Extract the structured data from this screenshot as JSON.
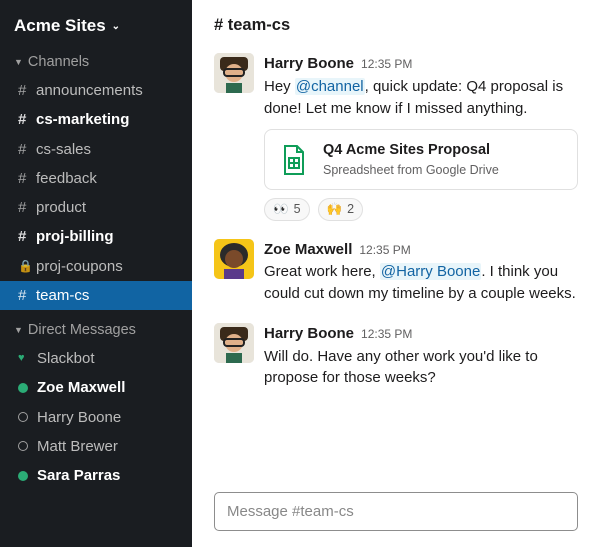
{
  "workspace": {
    "name": "Acme Sites"
  },
  "sections": {
    "channels_label": "Channels",
    "dms_label": "Direct Messages"
  },
  "channels": [
    {
      "name": "announcements",
      "unread": false,
      "active": false,
      "private": false
    },
    {
      "name": "cs-marketing",
      "unread": true,
      "active": false,
      "private": false
    },
    {
      "name": "cs-sales",
      "unread": false,
      "active": false,
      "private": false
    },
    {
      "name": "feedback",
      "unread": false,
      "active": false,
      "private": false
    },
    {
      "name": "product",
      "unread": false,
      "active": false,
      "private": false
    },
    {
      "name": "proj-billing",
      "unread": true,
      "active": false,
      "private": false
    },
    {
      "name": "proj-coupons",
      "unread": false,
      "active": false,
      "private": true
    },
    {
      "name": "team-cs",
      "unread": false,
      "active": true,
      "private": false
    }
  ],
  "dms": [
    {
      "name": "Slackbot",
      "status": "heart",
      "unread": false
    },
    {
      "name": "Zoe Maxwell",
      "status": "active",
      "unread": true
    },
    {
      "name": "Harry Boone",
      "status": "away",
      "unread": false
    },
    {
      "name": "Matt Brewer",
      "status": "away",
      "unread": false
    },
    {
      "name": "Sara Parras",
      "status": "active",
      "unread": true
    }
  ],
  "channel_header": "# team-cs",
  "messages": [
    {
      "sender": "Harry Boone",
      "time": "12:35 PM",
      "text_pre": "Hey ",
      "mention": "@channel",
      "text_post": ", quick update: Q4 proposal is done! Let me know if I missed anything.",
      "avatar": "harry",
      "attachment": {
        "title": "Q4 Acme Sites Proposal",
        "subtitle": "Spreadsheet from Google Drive",
        "icon": "sheets"
      },
      "reactions": [
        {
          "emoji": "👀",
          "count": "5"
        },
        {
          "emoji": "🙌",
          "count": "2"
        }
      ]
    },
    {
      "sender": "Zoe Maxwell",
      "time": "12:35 PM",
      "text_pre": "Great work here, ",
      "mention": "@Harry Boone",
      "text_post": ". I think you could cut down my timeline by a couple weeks.",
      "avatar": "zoe"
    },
    {
      "sender": "Harry Boone",
      "time": "12:35 PM",
      "text_pre": "Will do. Have any other work you'd like to propose for those weeks?",
      "avatar": "harry"
    }
  ],
  "composer": {
    "placeholder": "Message #team-cs"
  }
}
